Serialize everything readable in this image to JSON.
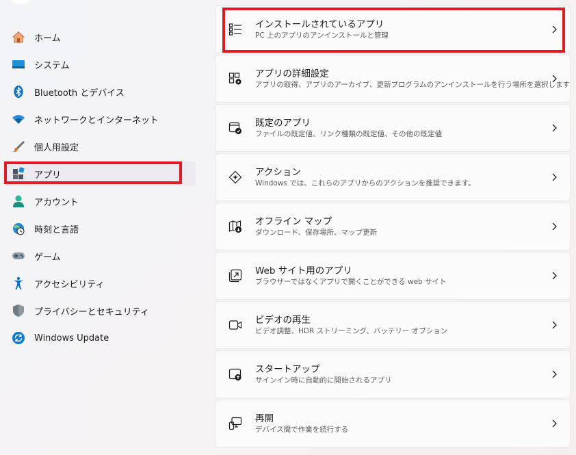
{
  "sidebar": {
    "items": [
      {
        "label": "ホーム",
        "icon": "home-icon"
      },
      {
        "label": "システム",
        "icon": "system-display-icon"
      },
      {
        "label": "Bluetooth とデバイス",
        "icon": "bluetooth-icon"
      },
      {
        "label": "ネットワークとインターネット",
        "icon": "wifi-icon"
      },
      {
        "label": "個人用設定",
        "icon": "brush-icon"
      },
      {
        "label": "アプリ",
        "icon": "apps-icon",
        "selected": true
      },
      {
        "label": "アカウント",
        "icon": "account-icon"
      },
      {
        "label": "時刻と言語",
        "icon": "time-language-icon"
      },
      {
        "label": "ゲーム",
        "icon": "gamepad-icon"
      },
      {
        "label": "アクセシビリティ",
        "icon": "accessibility-icon"
      },
      {
        "label": "プライバシーとセキュリティ",
        "icon": "shield-icon"
      },
      {
        "label": "Windows Update",
        "icon": "windows-update-icon"
      }
    ]
  },
  "main": {
    "cards": [
      {
        "title": "インストールされているアプリ",
        "subtitle": "PC 上のアプリのアンインストールと管理",
        "icon": "installed-apps-icon"
      },
      {
        "title": "アプリの詳細設定",
        "subtitle": "アプリの取得、アプリのアーカイブ、更新プログラムのアンインストールを行う場所を選択します",
        "icon": "advanced-app-settings-icon"
      },
      {
        "title": "既定のアプリ",
        "subtitle": "ファイルの既定値、リンク種類の既定値、その他の既定値",
        "icon": "default-apps-icon"
      },
      {
        "title": "アクション",
        "subtitle": "Windows では、これらのアプリからのアクションを推奨できます。",
        "icon": "actions-icon"
      },
      {
        "title": "オフライン マップ",
        "subtitle": "ダウンロード、保存場所、マップ更新",
        "icon": "offline-maps-icon"
      },
      {
        "title": "Web サイト用のアプリ",
        "subtitle": "ブラウザーではなくアプリで開くことができる web サイト",
        "icon": "apps-for-websites-icon"
      },
      {
        "title": "ビデオの再生",
        "subtitle": "ビデオ調整、HDR ストリーミング、バッテリー オプション",
        "icon": "video-playback-icon"
      },
      {
        "title": "スタートアップ",
        "subtitle": "サインイン時に自動的に開始されるアプリ",
        "icon": "startup-icon"
      },
      {
        "title": "再開",
        "subtitle": "デバイス間で作業を続行する",
        "icon": "resume-icon"
      }
    ]
  },
  "colors": {
    "highlight": "#e01b24",
    "accent": "#0067c0"
  }
}
